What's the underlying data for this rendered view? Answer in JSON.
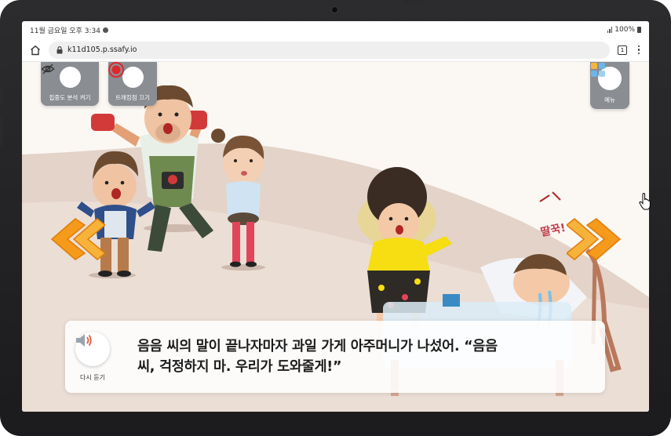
{
  "status_bar": {
    "time": "11월 금요일 오후 3:34",
    "battery": "100%"
  },
  "browser": {
    "url": "k11d105.p.ssafy.io",
    "tab_count": "1"
  },
  "toolbar": {
    "focus_analysis_label": "집중도 분석 켜기",
    "tracking_label": "트래킹점 끄기",
    "menu_label": "메뉴"
  },
  "story": {
    "listen_again_label": "다시 듣기",
    "line1": "음음 씨의 말이 끝나자마자 과일 가게 아주머니가 나섰어. “음음",
    "line2": "씨, 걱정하지 마. 우리가 도와줄게!”",
    "sound_effect": "딸꾹!"
  },
  "colors": {
    "accent_orange": "#f59a1b",
    "button_gray": "#8a8d92",
    "tracking_red": "#e0262b"
  }
}
